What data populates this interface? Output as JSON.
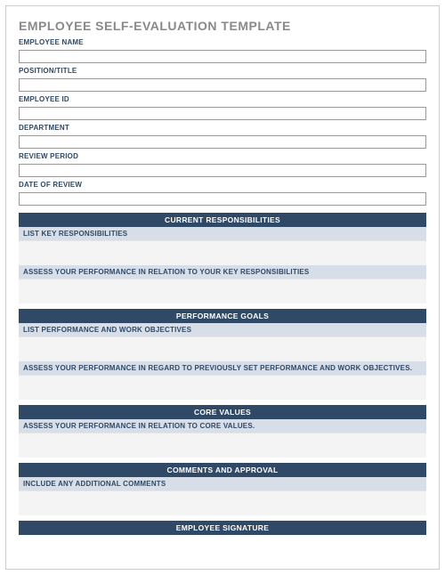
{
  "title": "EMPLOYEE SELF-EVALUATION TEMPLATE",
  "fields": {
    "employee_name": {
      "label": "EMPLOYEE NAME",
      "value": ""
    },
    "position_title": {
      "label": "POSITION/TITLE",
      "value": ""
    },
    "employee_id": {
      "label": "EMPLOYEE ID",
      "value": ""
    },
    "department": {
      "label": "DEPARTMENT",
      "value": ""
    },
    "review_period": {
      "label": "REVIEW PERIOD",
      "value": ""
    },
    "date_of_review": {
      "label": "DATE OF REVIEW",
      "value": ""
    }
  },
  "sections": {
    "current_responsibilities": {
      "header": "CURRENT RESPONSIBILITIES",
      "sub1": "LIST KEY RESPONSIBILITIES",
      "sub2": "ASSESS YOUR PERFORMANCE IN RELATION TO YOUR KEY RESPONSIBILITIES"
    },
    "performance_goals": {
      "header": "PERFORMANCE GOALS",
      "sub1": "LIST PERFORMANCE AND WORK OBJECTIVES",
      "sub2": "ASSESS YOUR PERFORMANCE IN REGARD TO PREVIOUSLY SET PERFORMANCE AND WORK OBJECTIVES."
    },
    "core_values": {
      "header": "CORE VALUES",
      "sub1": "ASSESS YOUR PERFORMANCE IN RELATION TO CORE VALUES."
    },
    "comments_approval": {
      "header": "COMMENTS AND APPROVAL",
      "sub1": "INCLUDE ANY ADDITIONAL COMMENTS"
    },
    "employee_signature": {
      "header": "EMPLOYEE SIGNATURE"
    }
  }
}
